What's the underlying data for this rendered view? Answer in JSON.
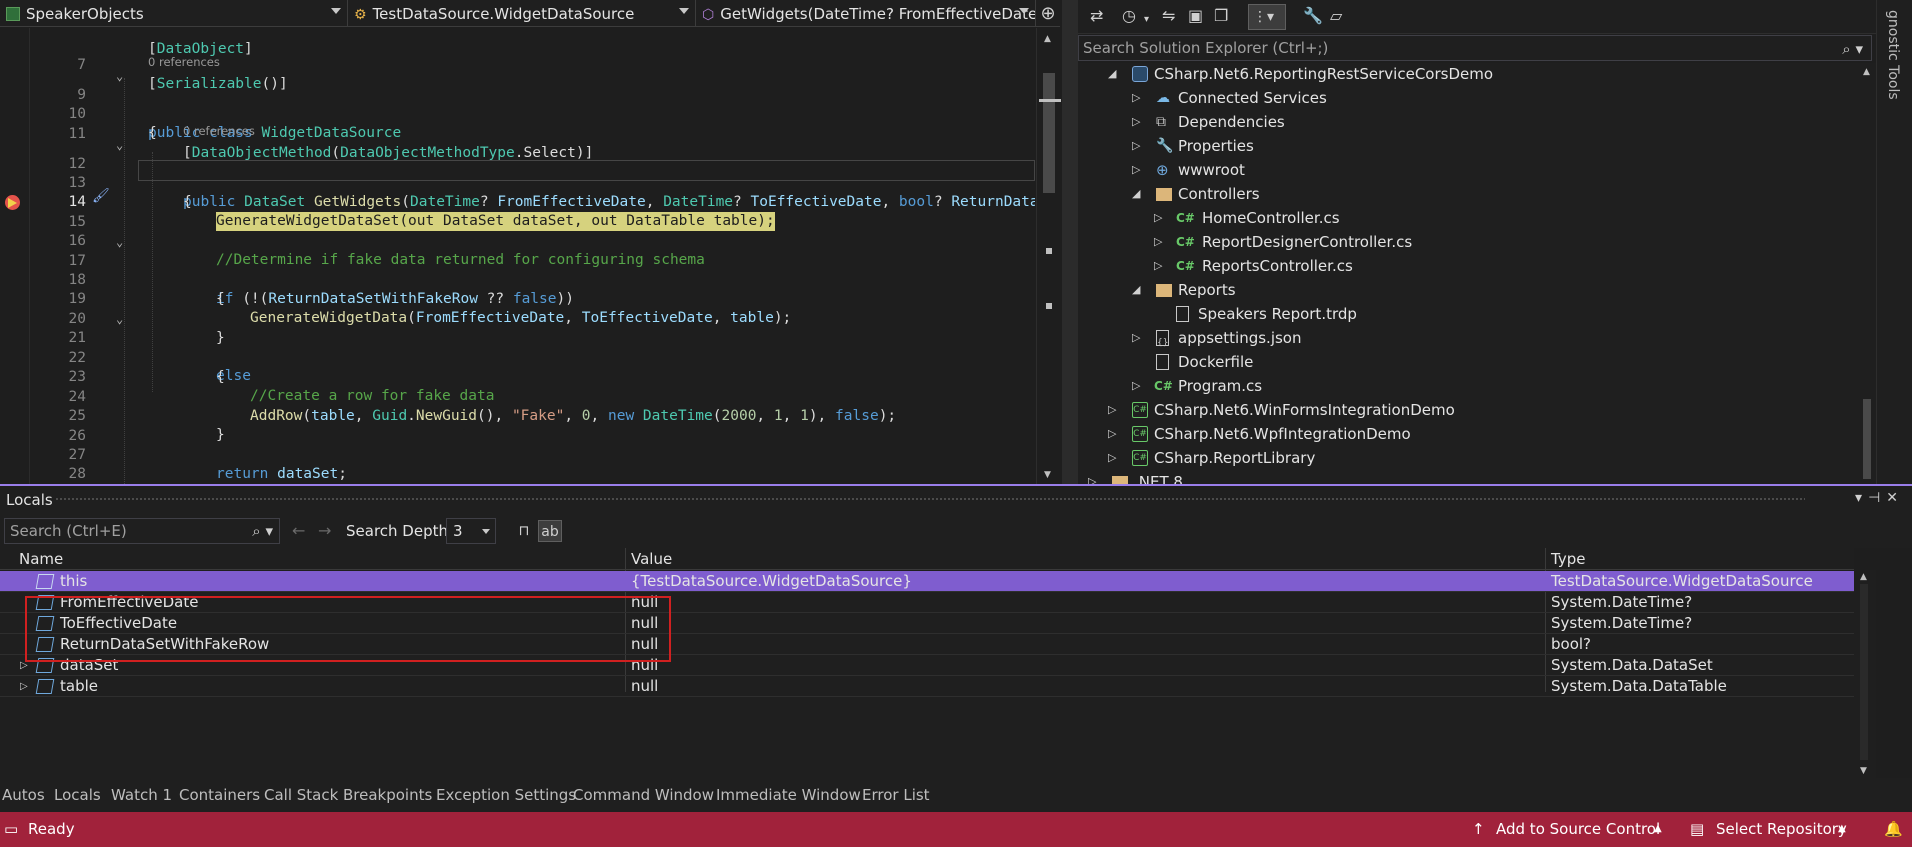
{
  "nav": {
    "project": "SpeakerObjects",
    "type": "TestDataSource.WidgetDataSource",
    "member": "GetWidgets(DateTime? FromEffectiveDate, D"
  },
  "editor": {
    "lines": [
      {
        "n": "",
        "text": "[DataObject]"
      },
      {
        "n": "7",
        "text": "[Serializable()]"
      },
      {
        "n": "9",
        "text": "public class WidgetDataSource"
      },
      {
        "n": "10",
        "text": "{"
      },
      {
        "n": "11",
        "text": "[DataObjectMethod(DataObjectMethodType.Select)]"
      },
      {
        "n": "12",
        "text": "public DataSet GetWidgets(DateTime? FromEffectiveDate, DateTime? ToEffectiveDate, bool? ReturnDataSe"
      },
      {
        "n": "13",
        "text": "{"
      },
      {
        "n": "14",
        "text": "GenerateWidgetDataSet(out DataSet dataSet, out DataTable table);"
      },
      {
        "n": "15",
        "text": ""
      },
      {
        "n": "16",
        "text": "//Determine if fake data returned for configuring schema"
      },
      {
        "n": "17",
        "text": "if (!(ReturnDataSetWithFakeRow ?? false))"
      },
      {
        "n": "18",
        "text": "{"
      },
      {
        "n": "19",
        "text": "GenerateWidgetData(FromEffectiveDate, ToEffectiveDate, table);"
      },
      {
        "n": "20",
        "text": "}"
      },
      {
        "n": "21",
        "text": "else"
      },
      {
        "n": "22",
        "text": "{"
      },
      {
        "n": "23",
        "text": "//Create a row for fake data"
      },
      {
        "n": "24",
        "text": "AddRow(table, Guid.NewGuid(), \"Fake\", 0, new DateTime(2000, 1, 1), false);"
      },
      {
        "n": "25",
        "text": "}"
      },
      {
        "n": "26",
        "text": ""
      },
      {
        "n": "27",
        "text": "return dataSet;"
      },
      {
        "n": "28",
        "text": "}"
      }
    ],
    "references_label": "0 references"
  },
  "solution_explorer": {
    "search_placeholder": "Search Solution Explorer (Ctrl+;)",
    "items": [
      {
        "label": "CSharp.Net6.ReportingRestServiceCorsDemo"
      },
      {
        "label": "Connected Services"
      },
      {
        "label": "Dependencies"
      },
      {
        "label": "Properties"
      },
      {
        "label": "wwwroot"
      },
      {
        "label": "Controllers"
      },
      {
        "label": "HomeController.cs"
      },
      {
        "label": "ReportDesignerController.cs"
      },
      {
        "label": "ReportsController.cs"
      },
      {
        "label": "Reports"
      },
      {
        "label": "Speakers Report.trdp"
      },
      {
        "label": "appsettings.json"
      },
      {
        "label": "Dockerfile"
      },
      {
        "label": "Program.cs"
      },
      {
        "label": "CSharp.Net6.WinFormsIntegrationDemo"
      },
      {
        "label": "CSharp.Net6.WpfIntegrationDemo"
      },
      {
        "label": "CSharp.ReportLibrary"
      },
      {
        "label": ".NET 8"
      }
    ]
  },
  "side_strip": {
    "label": "gnostic Tools"
  },
  "locals": {
    "title": "Locals",
    "search_placeholder": "Search (Ctrl+E)",
    "depth_label": "Search Depth:",
    "depth_value": "3",
    "columns": {
      "name": "Name",
      "value": "Value",
      "type": "Type"
    },
    "rows": [
      {
        "name": "this",
        "value": "{TestDataSource.WidgetDataSource}",
        "type": "TestDataSource.WidgetDataSource"
      },
      {
        "name": "FromEffectiveDate",
        "value": "null",
        "type": "System.DateTime?"
      },
      {
        "name": "ToEffectiveDate",
        "value": "null",
        "type": "System.DateTime?"
      },
      {
        "name": "ReturnDataSetWithFakeRow",
        "value": "null",
        "type": "bool?"
      },
      {
        "name": "dataSet",
        "value": "null",
        "type": "System.Data.DataSet"
      },
      {
        "name": "table",
        "value": "null",
        "type": "System.Data.DataTable"
      }
    ]
  },
  "tool_tabs": [
    "Autos",
    "Locals",
    "Watch 1",
    "Containers",
    "Call Stack",
    "Breakpoints",
    "Exception Settings",
    "Command Window",
    "Immediate Window",
    "Error List"
  ],
  "status": {
    "state": "Ready",
    "source_control": "Add to Source Control",
    "repository": "Select Repository"
  },
  "colors": {
    "status_bar": "#a1223b",
    "selection": "#7f5dcf",
    "highlight_box": "#d02020",
    "execution_line": "#d6d27e"
  }
}
